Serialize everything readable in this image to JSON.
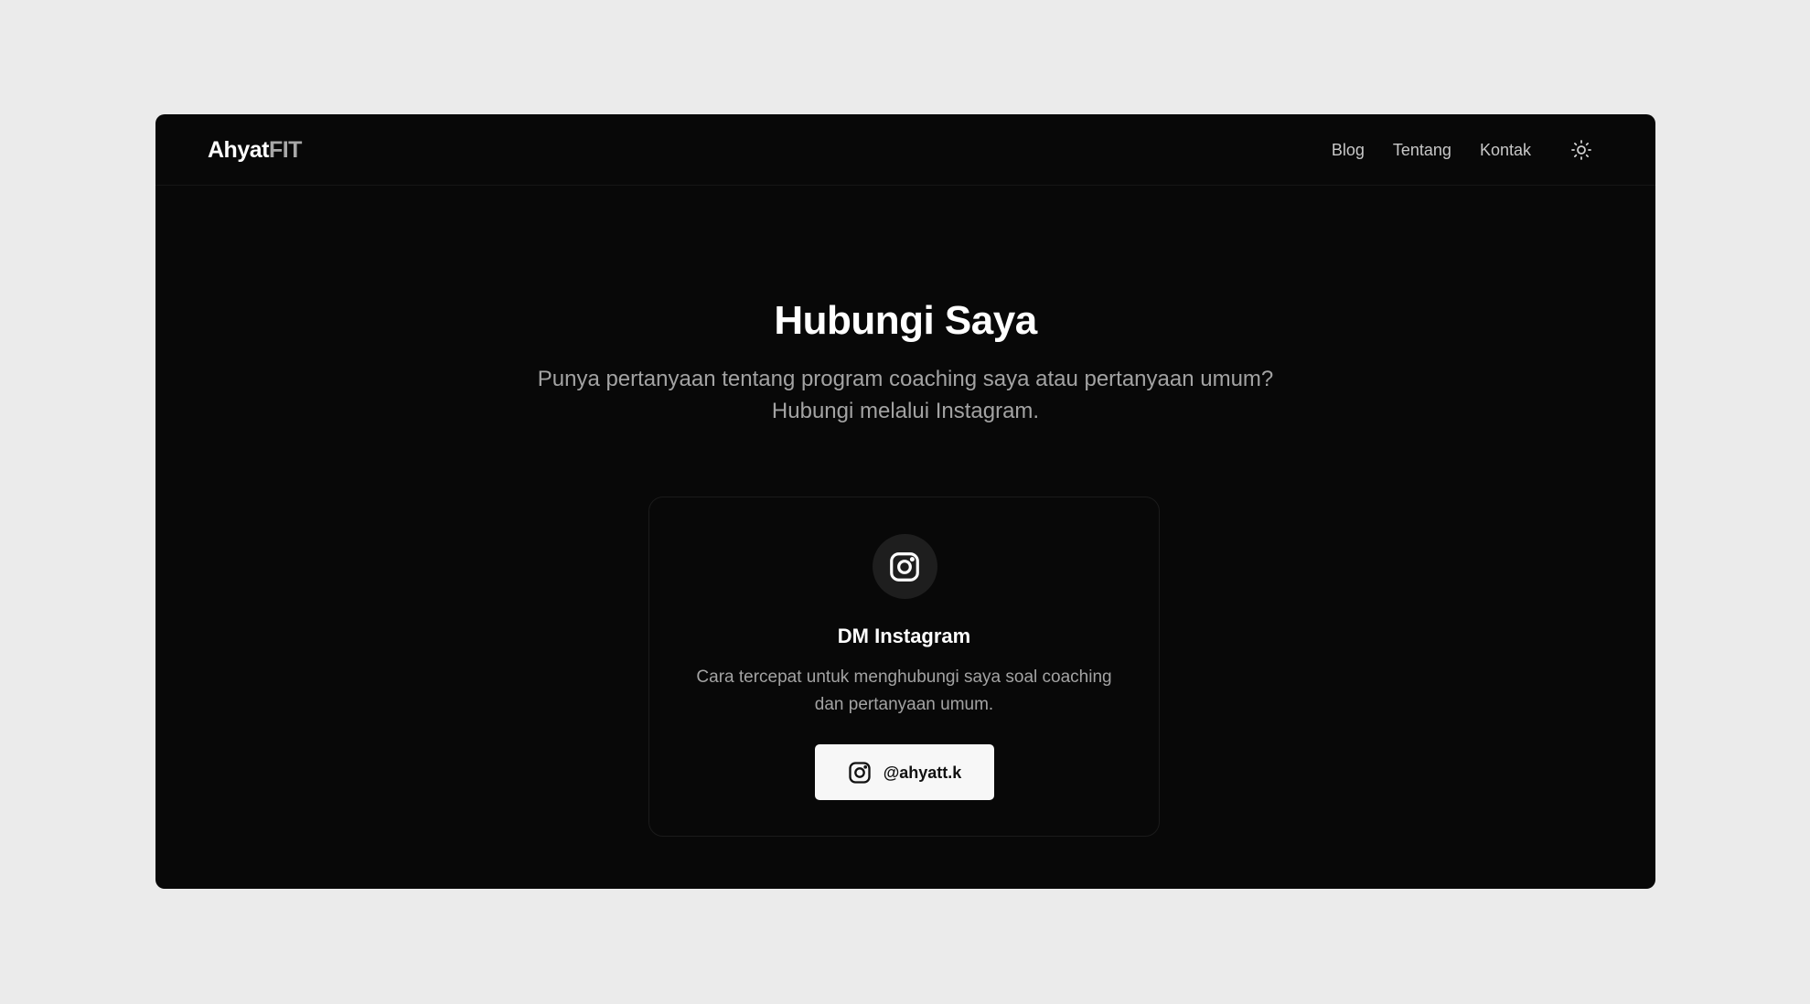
{
  "navbar": {
    "logo_main": "Ahyat",
    "logo_accent": "FIT",
    "links": [
      {
        "label": "Blog"
      },
      {
        "label": "Tentang"
      },
      {
        "label": "Kontak"
      }
    ],
    "theme_toggle_icon": "sun-icon"
  },
  "hero": {
    "title": "Hubungi Saya",
    "subtitle": "Punya pertanyaan tentang program coaching saya atau pertanyaan umum? Hubungi melalui Instagram."
  },
  "contact_card": {
    "icon": "instagram-icon",
    "title": "DM Instagram",
    "description": "Cara tercepat untuk menghubungi saya soal coaching dan pertanyaan umum.",
    "button_icon": "instagram-icon",
    "button_label": "@ahyatt.k"
  },
  "colors": {
    "page_background": "#ebebeb",
    "app_background": "#080808",
    "text_primary": "#ffffff",
    "text_muted": "#a3a3a3",
    "button_background": "#f7f7f7"
  }
}
